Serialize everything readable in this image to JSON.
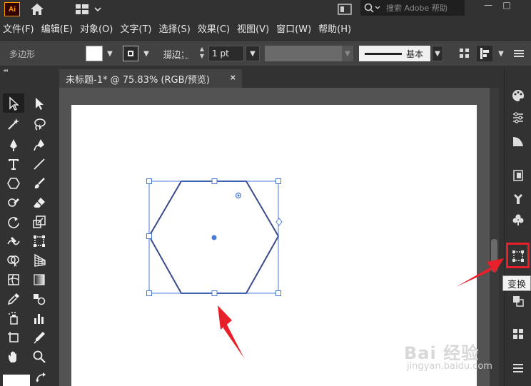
{
  "app": {
    "logo": "Ai"
  },
  "search": {
    "placeholder": "搜索 Adobe 帮助"
  },
  "window": {
    "minimize": "—",
    "restore": "□"
  },
  "menu": [
    "文件(F)",
    "编辑(E)",
    "对象(O)",
    "文字(T)",
    "选择(S)",
    "效果(C)",
    "视图(V)",
    "窗口(W)",
    "帮助(H)"
  ],
  "control": {
    "shape_name": "多边形",
    "stroke_label": "描边：",
    "stroke_weight": "1 pt",
    "brush_label": "基本",
    "fill_color": "#ffffff"
  },
  "document": {
    "tab_title": "未标题-1* @ 75.83% (RGB/预览)",
    "close": "×"
  },
  "tooltip": {
    "text": "变换"
  },
  "watermark": {
    "brand": "Bai  经验",
    "site": "jingyan.baidu.com"
  },
  "colors": {
    "accent": "#4a7bd8",
    "highlight": "#e8202a",
    "selection": "#3d6fd6"
  },
  "icons": {
    "tools": [
      "selection-tool-icon",
      "direct-selection-tool-icon",
      "magic-wand-icon",
      "lasso-icon",
      "pen-tool-icon",
      "curvature-tool-icon",
      "type-tool-icon",
      "line-tool-icon",
      "polygon-tool-icon",
      "paintbrush-icon",
      "shaper-tool-icon",
      "eraser-icon",
      "rotate-tool-icon",
      "scale-tool-icon",
      "warp-tool-icon",
      "free-transform-icon",
      "shape-builder-icon",
      "perspective-grid-icon",
      "mesh-tool-icon",
      "gradient-tool-icon",
      "eyedropper-icon",
      "blend-tool-icon",
      "symbol-sprayer-icon",
      "column-graph-icon",
      "artboard-tool-icon",
      "slice-tool-icon",
      "hand-tool-icon",
      "zoom-tool-icon"
    ],
    "panels": [
      "color-panel-icon",
      "properties-panel-icon",
      "color-guide-icon",
      "libraries-icon",
      "brushes-icon",
      "symbols-icon",
      "transform-panel-icon",
      "align-panel-icon",
      "pathfinder-icon",
      "swatches-icon",
      "layers-icon"
    ]
  }
}
